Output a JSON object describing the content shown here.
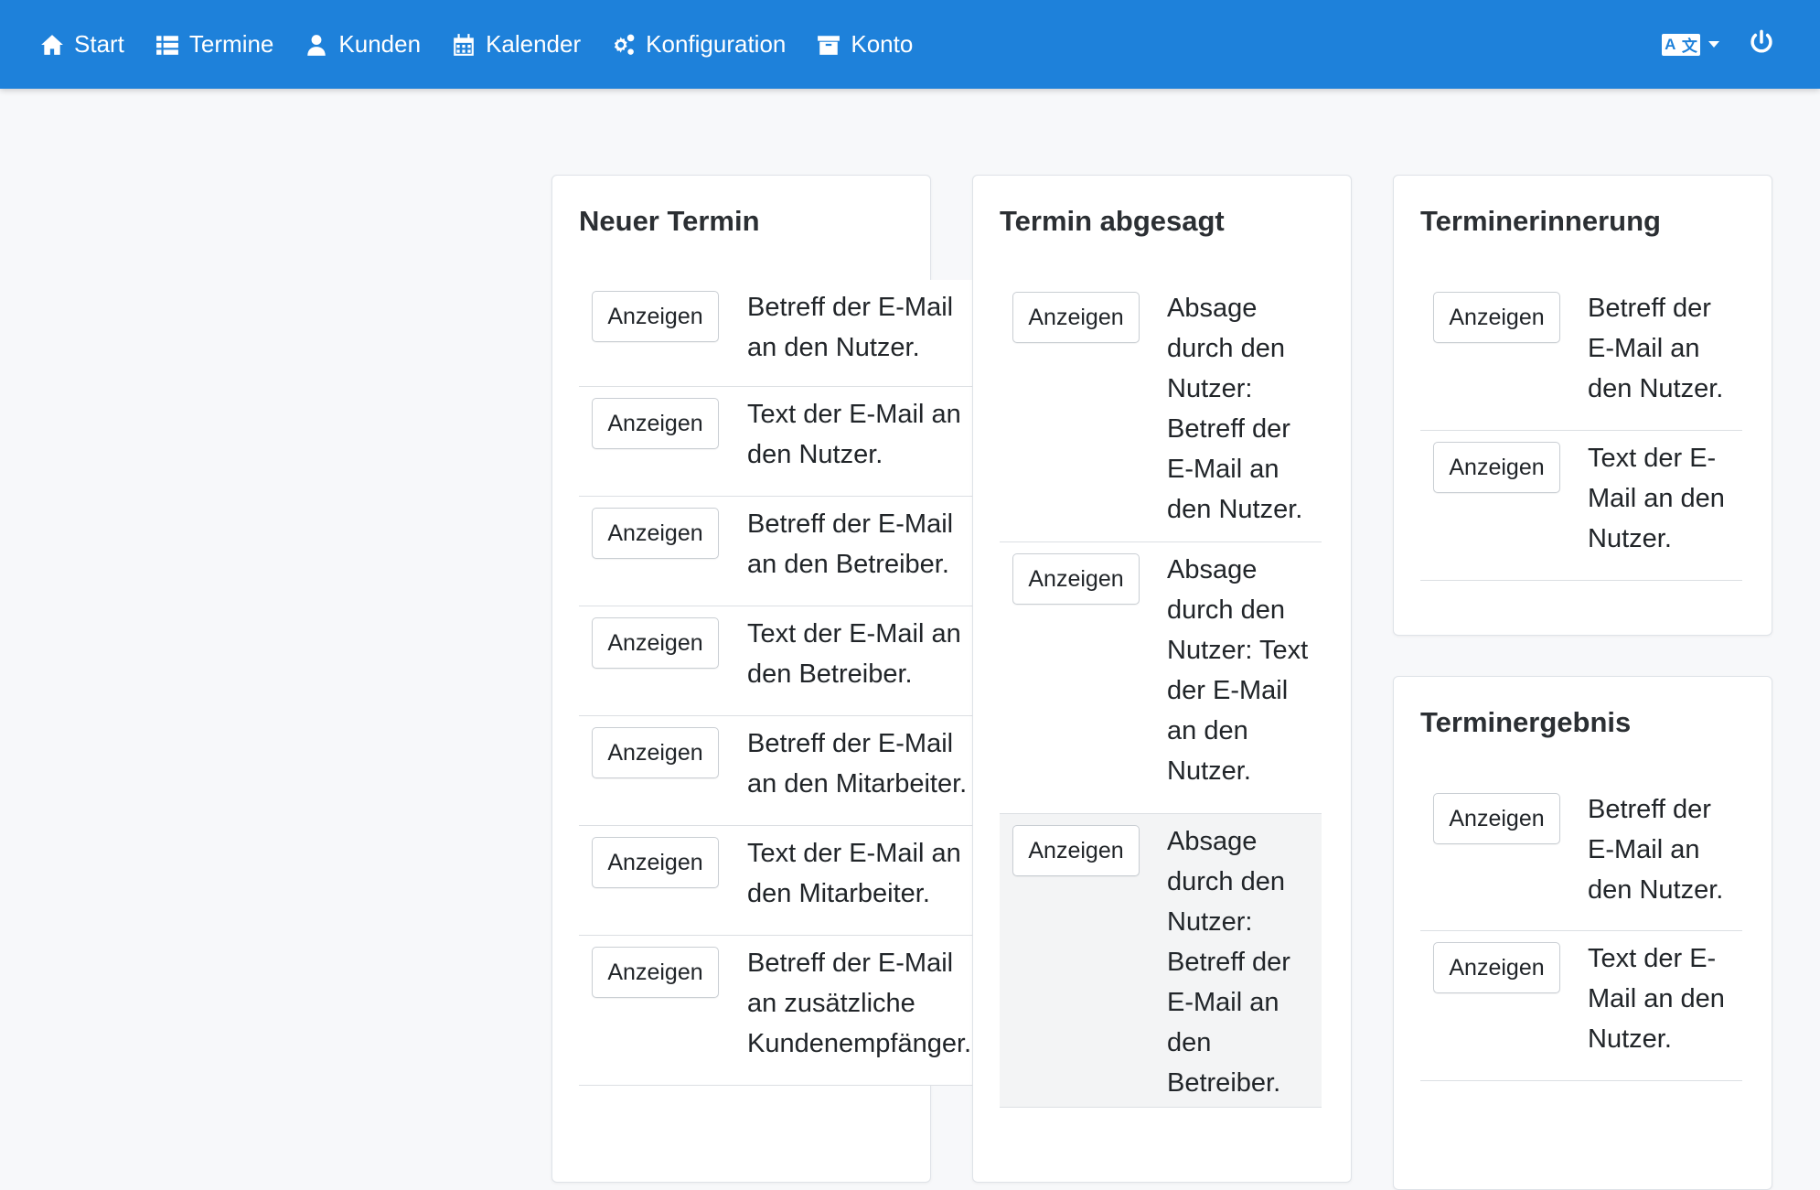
{
  "navbar": {
    "items": [
      {
        "label": "Start",
        "icon": "home-icon"
      },
      {
        "label": "Termine",
        "icon": "list-icon"
      },
      {
        "label": "Kunden",
        "icon": "user-icon"
      },
      {
        "label": "Kalender",
        "icon": "calendar-icon"
      },
      {
        "label": "Konfiguration",
        "icon": "cogs-icon"
      },
      {
        "label": "Konto",
        "icon": "archive-icon"
      }
    ],
    "language_icon": "language-icon",
    "logout_icon": "power-icon",
    "accent_color": "#1e81da"
  },
  "cards": {
    "neuer_termin": {
      "title": "Neuer Termin",
      "rows": [
        {
          "button": "Anzeigen",
          "text": "Betreff der E-Mail an den Nutzer."
        },
        {
          "button": "Anzeigen",
          "text": "Text der E-Mail an den Nutzer."
        },
        {
          "button": "Anzeigen",
          "text": "Betreff der E-Mail an den Betreiber."
        },
        {
          "button": "Anzeigen",
          "text": "Text der E-Mail an den Betreiber."
        },
        {
          "button": "Anzeigen",
          "text": "Betreff der E-Mail an den Mitarbeiter."
        },
        {
          "button": "Anzeigen",
          "text": "Text der E-Mail an den Mitarbeiter."
        },
        {
          "button": "Anzeigen",
          "text": "Betreff der E-Mail an zusätzliche Kundenempfänger."
        }
      ]
    },
    "termin_abgesagt": {
      "title": "Termin abgesagt",
      "rows": [
        {
          "button": "Anzeigen",
          "text": "Absage durch den Nutzer: Betreff der E-Mail an den Nutzer."
        },
        {
          "button": "Anzeigen",
          "text": "Absage durch den Nutzer: Text der E-Mail an den Nutzer."
        },
        {
          "button": "Anzeigen",
          "text": "Absage durch den Nutzer: Betreff der E-Mail an den Betreiber."
        }
      ]
    },
    "terminerinnerung": {
      "title": "Terminerinnerung",
      "rows": [
        {
          "button": "Anzeigen",
          "text": "Betreff der E-Mail an den Nutzer."
        },
        {
          "button": "Anzeigen",
          "text": "Text der E-Mail an den Nutzer."
        }
      ]
    },
    "terminergebnis": {
      "title": "Terminergebnis",
      "rows": [
        {
          "button": "Anzeigen",
          "text": "Betreff der E-Mail an den Nutzer."
        },
        {
          "button": "Anzeigen",
          "text": "Text der E-Mail an den Nutzer."
        }
      ]
    }
  }
}
